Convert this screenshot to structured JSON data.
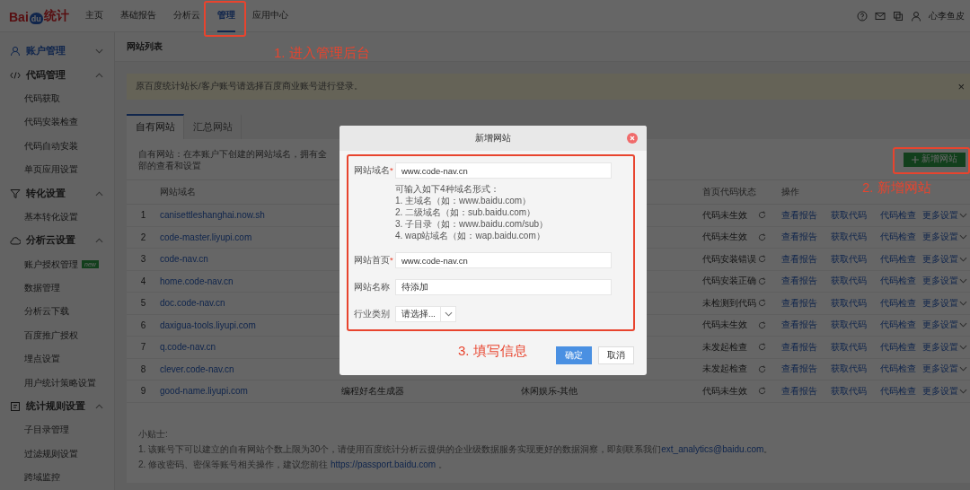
{
  "logo": {
    "left": "Bai",
    "middle": "du",
    "right": "统计"
  },
  "nav": [
    {
      "label": "主页",
      "selected": false
    },
    {
      "label": "基础报告",
      "selected": false
    },
    {
      "label": "分析云",
      "selected": false
    },
    {
      "label": "管理",
      "selected": true
    },
    {
      "label": "应用中心",
      "selected": false
    }
  ],
  "user": {
    "name": "心李鱼皮"
  },
  "sidebar": [
    {
      "label": "账户管理",
      "selected": true,
      "expanded": false
    },
    {
      "label": "代码管理",
      "selected": false,
      "expanded": true,
      "children": [
        {
          "label": "代码获取",
          "selected": false
        },
        {
          "label": "代码安装检查",
          "selected": false
        },
        {
          "label": "代码自动安装",
          "selected": false
        },
        {
          "label": "单页应用设置",
          "selected": false
        }
      ]
    },
    {
      "label": "转化设置",
      "selected": false,
      "expanded": true,
      "children": [
        {
          "label": "基本转化设置",
          "selected": false
        }
      ]
    },
    {
      "label": "分析云设置",
      "selected": false,
      "expanded": true,
      "children": [
        {
          "label": "账户授权管理",
          "selected": false,
          "badge": "new"
        },
        {
          "label": "数据管理",
          "selected": false
        },
        {
          "label": "分析云下载",
          "selected": false
        },
        {
          "label": "百度推广授权",
          "selected": false
        },
        {
          "label": "埋点设置",
          "selected": false
        },
        {
          "label": "用户统计策略设置",
          "selected": false
        }
      ]
    },
    {
      "label": "统计规则设置",
      "selected": false,
      "expanded": true,
      "children": [
        {
          "label": "子目录管理",
          "selected": false
        },
        {
          "label": "过滤规则设置",
          "selected": false
        },
        {
          "label": "跨域监控",
          "selected": false
        }
      ]
    }
  ],
  "page_title": "网站列表",
  "notice": {
    "text": "原百度统计站长/客户账号请选择百度商业账号进行登录。",
    "close": "×"
  },
  "tabs": [
    {
      "label": "自有网站",
      "selected": true
    },
    {
      "label": "汇总网站",
      "selected": false
    }
  ],
  "description": "自有网站：在本账户下创建的网站域名，拥有全部的查看和设置",
  "add_button": "新增网站",
  "table": {
    "columns": {
      "domain": "网站域名",
      "status": "首页代码状态",
      "actions": "操作"
    },
    "rows": [
      {
        "index": "1",
        "domain": "canisettleshanghai.now.sh",
        "status": "代码未生效",
        "actions": [
          "查看报告",
          "获取代码",
          "代码检查",
          "更多设置"
        ]
      },
      {
        "index": "2",
        "domain": "code-master.liyupi.com",
        "status": "代码未生效",
        "actions": [
          "查看报告",
          "获取代码",
          "代码检查",
          "更多设置"
        ]
      },
      {
        "index": "3",
        "domain": "code-nav.cn",
        "status": "代码安装错误",
        "actions": [
          "查看报告",
          "获取代码",
          "代码检查",
          "更多设置"
        ]
      },
      {
        "index": "4",
        "domain": "home.code-nav.cn",
        "status": "代码安装正确",
        "actions": [
          "查看报告",
          "获取代码",
          "代码检查",
          "更多设置"
        ]
      },
      {
        "index": "5",
        "domain": "doc.code-nav.cn",
        "status": "未检测到代码",
        "actions": [
          "查看报告",
          "获取代码",
          "代码检查",
          "更多设置"
        ]
      },
      {
        "index": "6",
        "domain": "daxigua-tools.liyupi.com",
        "status": "代码未生效",
        "actions": [
          "查看报告",
          "获取代码",
          "代码检查",
          "更多设置"
        ]
      },
      {
        "index": "7",
        "domain": "q.code-nav.cn",
        "status": "未发起检查",
        "actions": [
          "查看报告",
          "获取代码",
          "代码检查",
          "更多设置"
        ]
      },
      {
        "index": "8",
        "domain": "clever.code-nav.cn",
        "status": "未发起检查",
        "actions": [
          "查看报告",
          "获取代码",
          "代码检查",
          "更多设置"
        ]
      },
      {
        "index": "9",
        "domain": "good-name.liyupi.com",
        "name": "编程好名生成器",
        "industry": "休闲娱乐-其他",
        "status": "代码未生效",
        "actions": [
          "查看报告",
          "获取代码",
          "代码检查",
          "更多设置"
        ]
      }
    ]
  },
  "tips": {
    "title": "小贴士:",
    "lines": [
      {
        "text": "1. 该账号下可以建立的自有网站个数上限为30个，请使用百度统计分析云提供的企业级数据服务实现更好的数据洞察，即刻联系我们",
        "link": "ext_analytics@baidu.com",
        "end": "。"
      },
      {
        "text": "2. 修改密码、密保等账号相关操作，建议您前往 ",
        "link": "https://passport.baidu.com",
        "end": " 。"
      }
    ]
  },
  "modal": {
    "title": "新增网站",
    "fields": [
      {
        "kind": "text",
        "label": "网站域名",
        "required_mark": "*",
        "value": "www.code-nav.cn",
        "hint": [
          "可输入如下4种域名形式：",
          "1. 主域名（如：www.baidu.com）",
          "2. 二级域名（如：sub.baidu.com）",
          "3. 子目录（如：www.baidu.com/sub）",
          "4. wap站域名（如：wap.baidu.com）"
        ]
      },
      {
        "kind": "text",
        "label": "网站首页",
        "required_mark": "*",
        "value": "www.code-nav.cn"
      },
      {
        "kind": "text",
        "label": "网站名称",
        "value": "待添加"
      },
      {
        "kind": "select",
        "label": "行业类别",
        "value": "请选择..."
      }
    ],
    "ok": "确定",
    "cancel": "取消"
  },
  "annotations": [
    "1. 进入管理后台",
    "2. 新增网站",
    "3. 填写信息"
  ]
}
